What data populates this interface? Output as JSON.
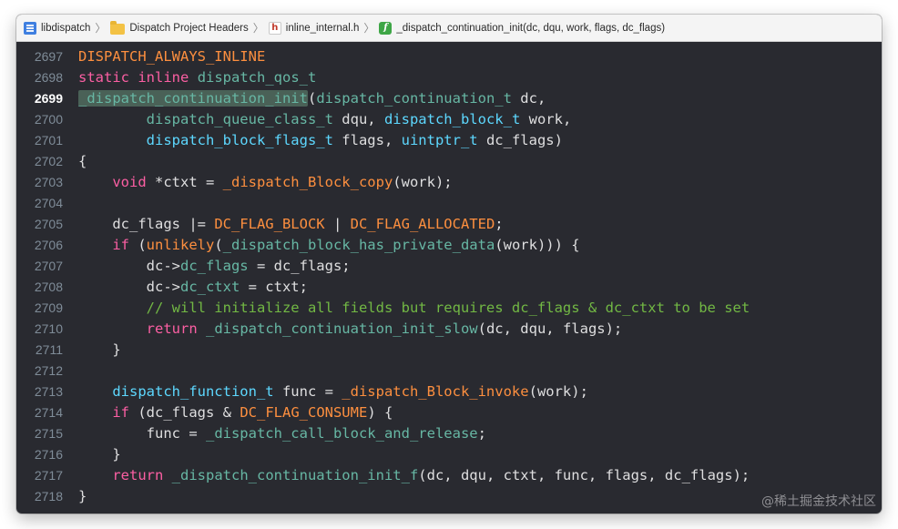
{
  "colors": {
    "background": "#292a30",
    "plain": "#dfdfe0",
    "keyword": "#fc5fa3",
    "type": "#67b7a4",
    "type_project": "#5dd8ff",
    "macro": "#fd8f3f",
    "project_function": "#41a1c0",
    "function_other": "#d0a8ff",
    "member": "#a167e6",
    "comment": "#6c7986",
    "number": "#d0bf69",
    "project_function_call": "#d9c97c"
  },
  "breadcrumb": [
    {
      "icon": "document-icon",
      "label": "libdispatch"
    },
    {
      "icon": "folder-icon",
      "label": "Dispatch Project Headers"
    },
    {
      "icon": "header-file-icon",
      "label": "inline_internal.h"
    },
    {
      "icon": "function-icon",
      "label": "_dispatch_continuation_init(dc, dqu, work, flags, dc_flags)"
    }
  ],
  "editor": {
    "current_line": "2699",
    "lines": [
      {
        "n": "2697",
        "tokens": [
          [
            "DISPATCH_ALWAYS_INLINE",
            "#fd8f3f"
          ]
        ]
      },
      {
        "n": "2698",
        "tokens": [
          [
            "static",
            "#fc5fa3"
          ],
          [
            " ",
            ""
          ],
          [
            "inline",
            "#fc5fa3"
          ],
          [
            " ",
            ""
          ],
          [
            "dispatch_qos_t",
            "#67b7a4"
          ]
        ]
      },
      {
        "n": "2699",
        "tokens": [
          [
            "_dispatch_continuation_init",
            "#67b7a4",
            "hl"
          ],
          [
            "(",
            ""
          ],
          [
            "dispatch_continuation_t",
            "#67b7a4"
          ],
          [
            " dc,",
            ""
          ]
        ]
      },
      {
        "n": "2700",
        "tokens": [
          [
            "        ",
            ""
          ],
          [
            "dispatch_queue_class_t",
            "#67b7a4"
          ],
          [
            " dqu, ",
            ""
          ],
          [
            "dispatch_block_t",
            "#5dd8ff"
          ],
          [
            " work,",
            ""
          ]
        ]
      },
      {
        "n": "2701",
        "tokens": [
          [
            "        ",
            ""
          ],
          [
            "dispatch_block_flags_t",
            "#5dd8ff"
          ],
          [
            " flags, ",
            ""
          ],
          [
            "uintptr_t",
            "#5dd8ff"
          ],
          [
            " dc_flags)",
            ""
          ]
        ]
      },
      {
        "n": "2702",
        "tokens": [
          [
            "{",
            ""
          ]
        ]
      },
      {
        "n": "2703",
        "tokens": [
          [
            "    ",
            ""
          ],
          [
            "void",
            "#fc5fa3"
          ],
          [
            " *ctxt = ",
            ""
          ],
          [
            "_dispatch_Block_copy",
            "#fd8f3f"
          ],
          [
            "(work);",
            ""
          ]
        ]
      },
      {
        "n": "2704",
        "tokens": []
      },
      {
        "n": "2705",
        "tokens": [
          [
            "    dc_flags |= ",
            ""
          ],
          [
            "DC_FLAG_BLOCK",
            "#fd8f3f"
          ],
          [
            " | ",
            ""
          ],
          [
            "DC_FLAG_ALLOCATED",
            "#fd8f3f"
          ],
          [
            ";",
            ""
          ]
        ]
      },
      {
        "n": "2706",
        "tokens": [
          [
            "    ",
            ""
          ],
          [
            "if",
            "#fc5fa3"
          ],
          [
            " (",
            ""
          ],
          [
            "unlikely",
            "#fd8f3f"
          ],
          [
            "(",
            ""
          ],
          [
            "_dispatch_block_has_private_data",
            "#67b7a4"
          ],
          [
            "(work))) {",
            ""
          ]
        ]
      },
      {
        "n": "2707",
        "tokens": [
          [
            "        dc->",
            ""
          ],
          [
            "dc_flags",
            "#67b7a4"
          ],
          [
            " = dc_flags;",
            ""
          ]
        ]
      },
      {
        "n": "2708",
        "tokens": [
          [
            "        dc->",
            ""
          ],
          [
            "dc_ctxt",
            "#67b7a4"
          ],
          [
            " = ctxt;",
            ""
          ]
        ]
      },
      {
        "n": "2709",
        "tokens": [
          [
            "        ",
            ""
          ],
          [
            "// will initialize all fields but requires dc_flags & dc_ctxt to be set",
            "#72b844"
          ]
        ]
      },
      {
        "n": "2710",
        "tokens": [
          [
            "        ",
            ""
          ],
          [
            "return",
            "#fc5fa3"
          ],
          [
            " ",
            ""
          ],
          [
            "_dispatch_continuation_init_slow",
            "#67b7a4"
          ],
          [
            "(dc, dqu, flags);",
            ""
          ]
        ]
      },
      {
        "n": "2711",
        "tokens": [
          [
            "    }",
            ""
          ]
        ]
      },
      {
        "n": "2712",
        "tokens": []
      },
      {
        "n": "2713",
        "tokens": [
          [
            "    ",
            ""
          ],
          [
            "dispatch_function_t",
            "#5dd8ff"
          ],
          [
            " func = ",
            ""
          ],
          [
            "_dispatch_Block_invoke",
            "#fd8f3f"
          ],
          [
            "(work);",
            ""
          ]
        ]
      },
      {
        "n": "2714",
        "tokens": [
          [
            "    ",
            ""
          ],
          [
            "if",
            "#fc5fa3"
          ],
          [
            " (dc_flags & ",
            ""
          ],
          [
            "DC_FLAG_CONSUME",
            "#fd8f3f"
          ],
          [
            ") {",
            ""
          ]
        ]
      },
      {
        "n": "2715",
        "tokens": [
          [
            "        func = ",
            ""
          ],
          [
            "_dispatch_call_block_and_release",
            "#67b7a4"
          ],
          [
            ";",
            ""
          ]
        ]
      },
      {
        "n": "2716",
        "tokens": [
          [
            "    }",
            ""
          ]
        ]
      },
      {
        "n": "2717",
        "tokens": [
          [
            "    ",
            ""
          ],
          [
            "return",
            "#fc5fa3"
          ],
          [
            " ",
            ""
          ],
          [
            "_dispatch_continuation_init_f",
            "#67b7a4"
          ],
          [
            "(dc, dqu, ctxt, func, flags, dc_flags);",
            ""
          ]
        ]
      },
      {
        "n": "2718",
        "tokens": [
          [
            "}",
            ""
          ]
        ]
      }
    ]
  },
  "watermark": "@稀土掘金技术社区"
}
